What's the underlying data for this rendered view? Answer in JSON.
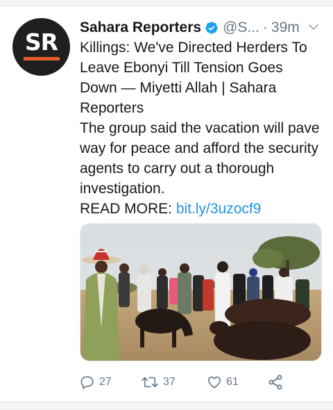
{
  "tweet": {
    "author": {
      "avatar_text": "SR",
      "name": "Sahara Reporters",
      "handle": "@S...",
      "separator": "·",
      "time": "39m",
      "verified": true
    },
    "text": {
      "headline": "Killings: We've Directed Herders To Leave Ebonyi Till Tension Goes Down — Miyetti Allah | Sahara Reporters",
      "summary": "The group said the vacation will pave way for peace and afford the security agents to carry out a thorough investigation.",
      "read_more_label": "READ MORE: ",
      "link_text": "bit.ly/3uzocf9"
    },
    "media": {
      "description_icon": "photo"
    },
    "actions": {
      "replies": "27",
      "retweets": "37",
      "likes": "61"
    }
  },
  "colors": {
    "link": "#1b95e0",
    "muted": "#657786",
    "verified": "#1da1f2",
    "avatar_bg": "#1f1f1f",
    "avatar_accent": "#e85d2a"
  },
  "icons": [
    "verified-badge-icon",
    "chevron-down-icon",
    "reply-icon",
    "retweet-icon",
    "like-icon",
    "share-icon"
  ]
}
